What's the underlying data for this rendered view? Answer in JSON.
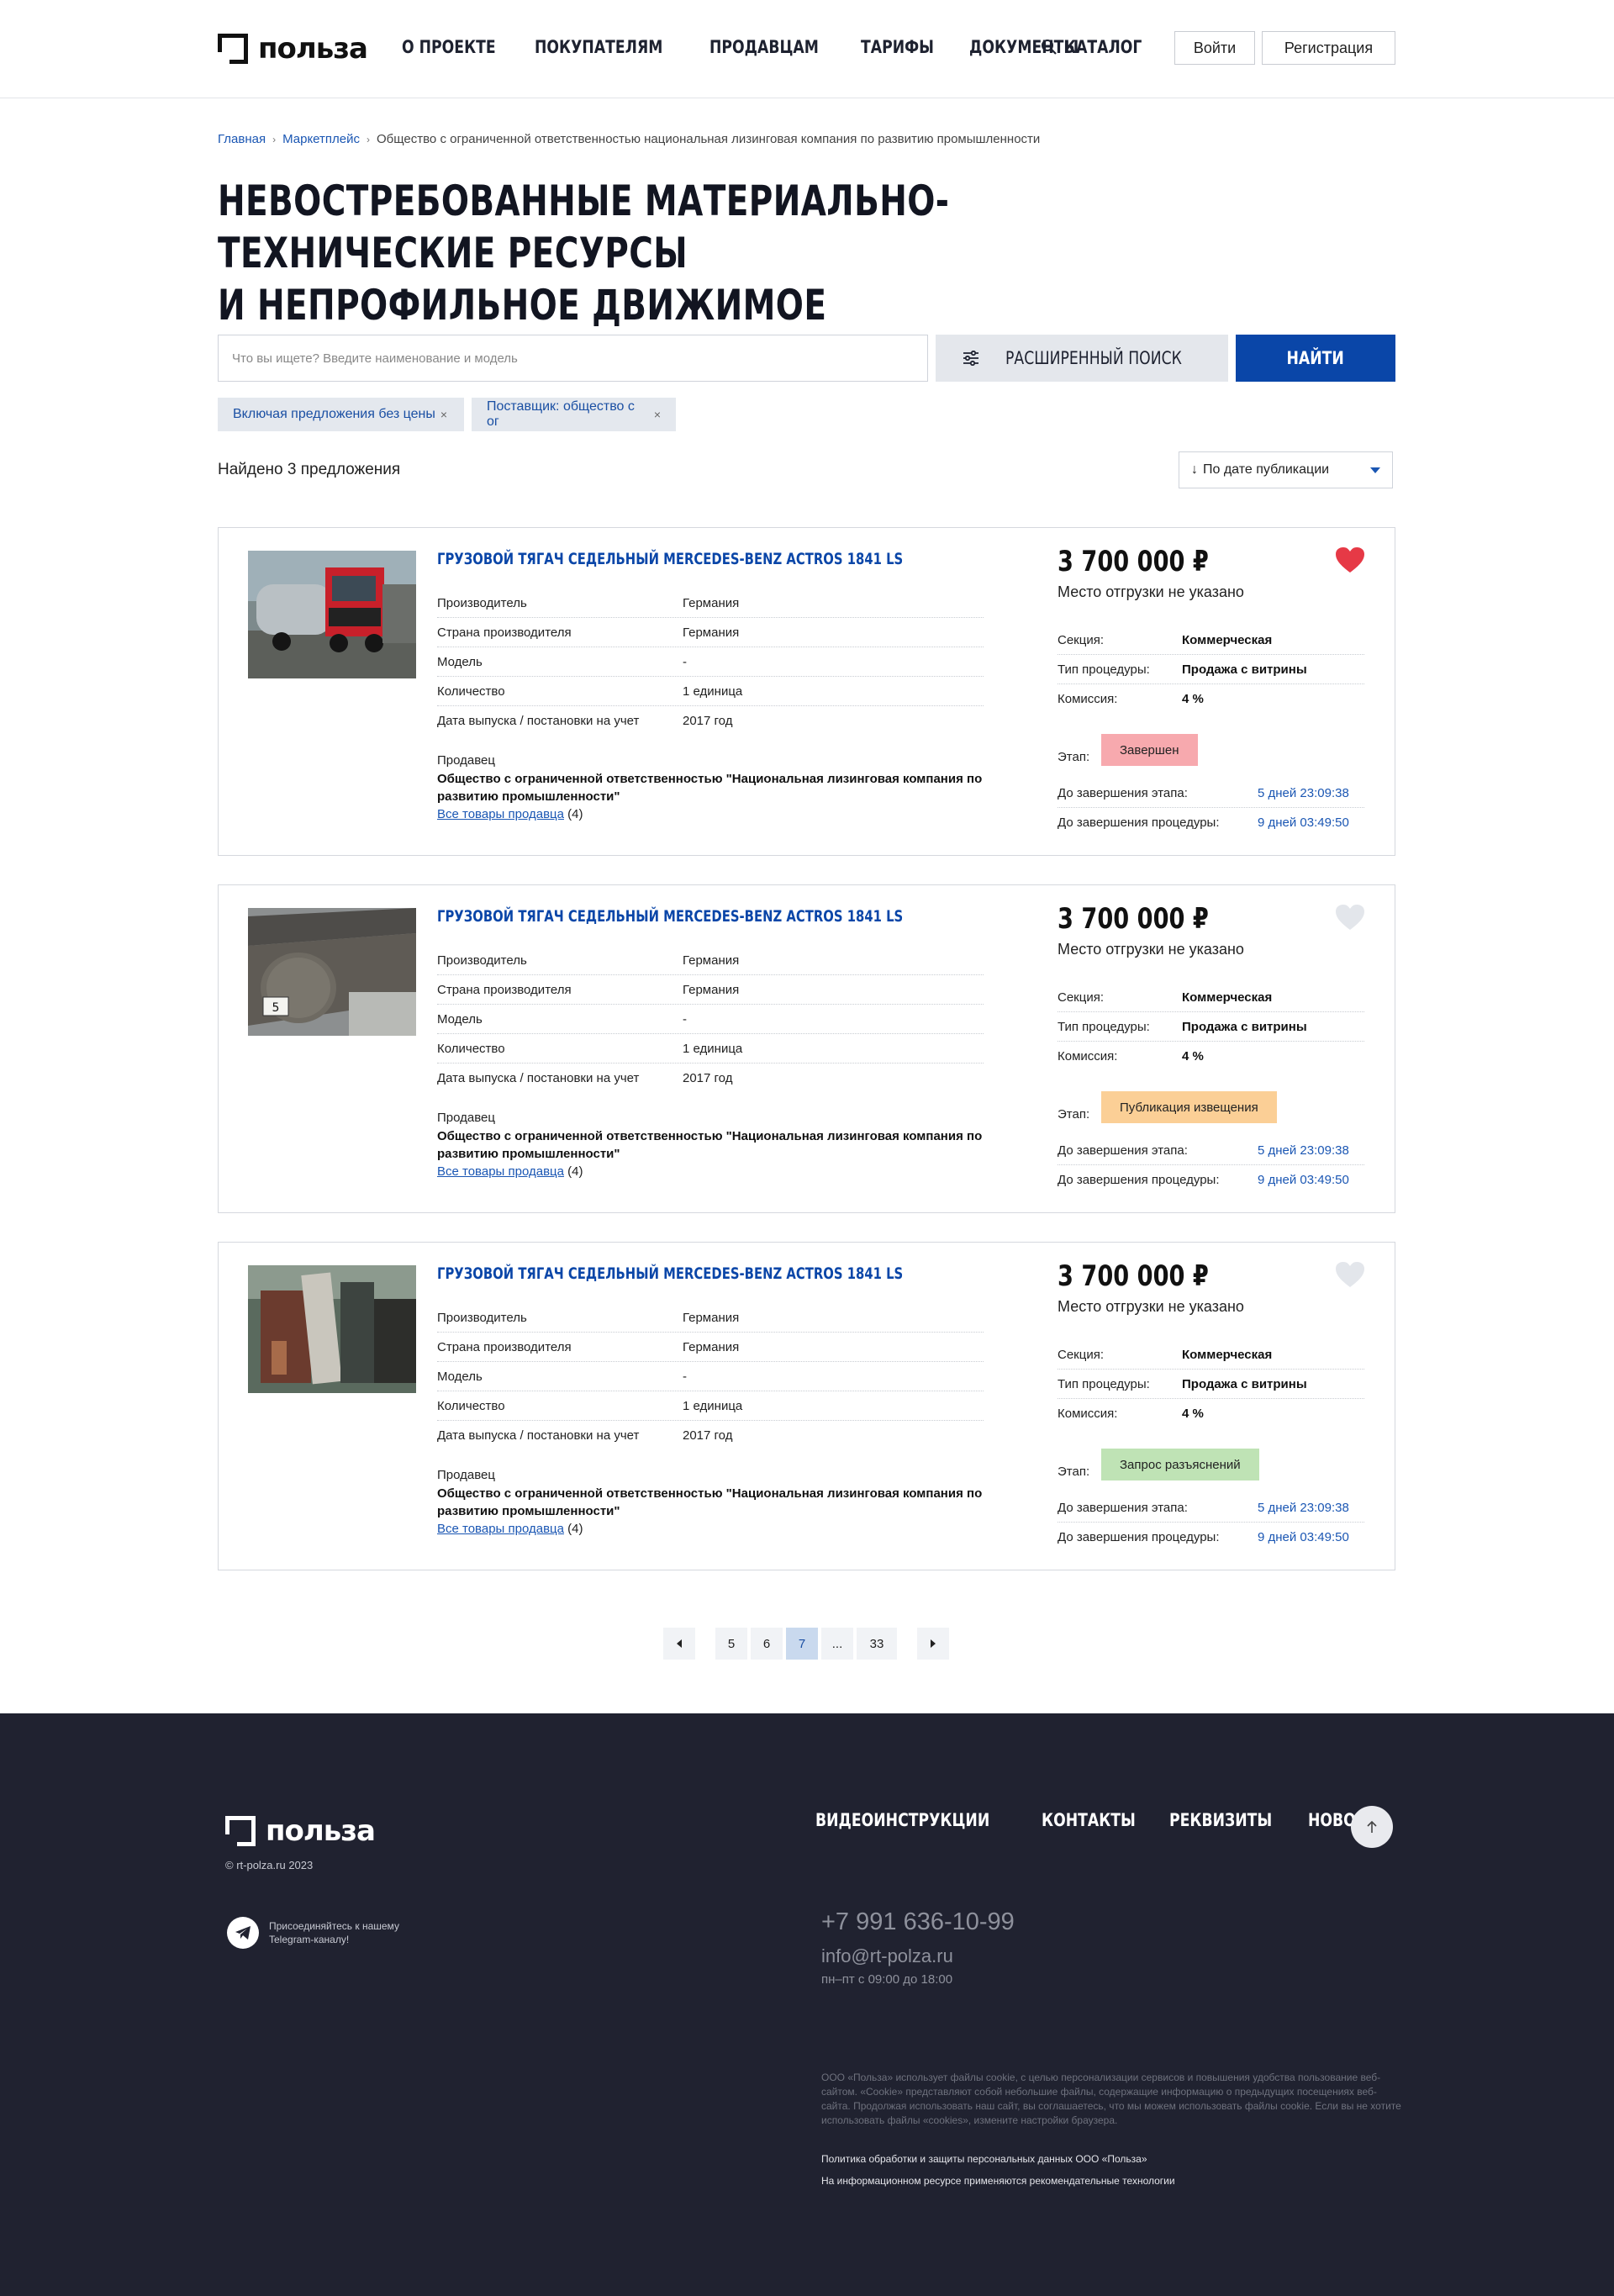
{
  "header": {
    "logo": "польза",
    "nav": [
      "О ПРОЕКТЕ",
      "ПОКУПАТЕЛЯМ",
      "ПРОДАВЦАМ",
      "ТАРИФЫ",
      "ДОКУМЕНТЫ"
    ],
    "catalog": "КАТАЛОГ",
    "login": "Войти",
    "register": "Регистрация"
  },
  "breadcrumbs": [
    "Главная",
    "Маркетплейс",
    "Общество с ограниченной ответственностью национальная лизинговая компания по развитию промышленности"
  ],
  "title_line1": "НЕВОСТРЕБОВАННЫЕ МАТЕРИАЛЬНО-ТЕХНИЧЕСКИЕ РЕСУРСЫ",
  "title_line2": "И НЕПРОФИЛЬНОЕ ДВИЖИМОЕ ИМУЩЕСТВО",
  "search": {
    "placeholder": "Что вы ищете? Введите наименование и модель",
    "advanced": "РАСШИРЕННЫЙ ПОИСК",
    "find": "НАЙТИ"
  },
  "filters": [
    "Включая предложения без цены",
    "Поставщик: общество с ог"
  ],
  "found": "Найдено 3 предложения",
  "sort": "По дате публикации",
  "spec_labels": [
    "Производитель",
    "Страна производителя",
    "Модель",
    "Количество",
    "Дата выпуска / постановки на учет"
  ],
  "right_labels": [
    "Секция:",
    "Тип процедуры:",
    "Комиссия:"
  ],
  "stage_label": "Этап:",
  "time_labels": [
    "До завершения этапа:",
    "До завершения процедуры:"
  ],
  "seller_label": "Продавец",
  "all_goods": "Все товары продавца",
  "colors": {
    "accent": "#0a46a8",
    "stage_done": "#f7a9ae",
    "stage_publish": "#fbcf96",
    "stage_request": "#bfe3b5",
    "heart_active": "#e63946",
    "heart_inactive": "#e3e6eb"
  },
  "cards": [
    {
      "title": "ГРУЗОВОЙ ТЯГАЧ СЕДЕЛЬНЫЙ MERCEDES-BENZ ACTROS 1841 LS",
      "specs": [
        "Германия",
        "Германия",
        "-",
        "1 единица",
        "2017 год"
      ],
      "seller": "Общество с ограниченной ответственностью \"Национальная лизинговая компания по развитию промышленности\"",
      "seller_count": "(4)",
      "price": "3 700 000",
      "currency": "₽",
      "shipping": "Место отгрузки не указано",
      "section": "Коммерческая",
      "procedure": "Продажа с витрины",
      "commission": "4 %",
      "stage": "Завершен",
      "stage_end": "5 дней 23:09:38",
      "procedure_end": "9 дней 03:49:50",
      "favorite": true,
      "image": "truck-photo"
    },
    {
      "title": "ГРУЗОВОЙ ТЯГАЧ СЕДЕЛЬНЫЙ MERCEDES-BENZ ACTROS 1841 LS",
      "specs": [
        "Германия",
        "Германия",
        "-",
        "1 единица",
        "2017 год"
      ],
      "seller": "Общество с ограниченной ответственностью \"Национальная лизинговая компания по развитию промышленности\"",
      "seller_count": "(4)",
      "price": "3 700 000",
      "currency": "₽",
      "shipping": "Место отгрузки не указано",
      "section": "Коммерческая",
      "procedure": "Продажа с витрины",
      "commission": "4 %",
      "stage": "Публикация извещения",
      "stage_end": "5 дней 23:09:38",
      "procedure_end": "9 дней 03:49:50",
      "favorite": false,
      "image": "steel-bar-photo",
      "image_tag": "5"
    },
    {
      "title": "ГРУЗОВОЙ ТЯГАЧ СЕДЕЛЬНЫЙ MERCEDES-BENZ ACTROS 1841 LS",
      "specs": [
        "Германия",
        "Германия",
        "-",
        "1 единица",
        "2017 год"
      ],
      "seller": "Общество с ограниченной ответственностью \"Национальная лизинговая компания по развитию промышленности\"",
      "seller_count": "(4)",
      "price": "3 700 000",
      "currency": "₽",
      "shipping": "Место отгрузки не указано",
      "section": "Коммерческая",
      "procedure": "Продажа с витрины",
      "commission": "4 %",
      "stage": "Запрос разъяснений",
      "stage_end": "5 дней 23:09:38",
      "procedure_end": "9 дней 03:49:50",
      "favorite": false,
      "image": "warehouse-photo"
    }
  ],
  "pagination": [
    "5",
    "6",
    "7",
    "...",
    "33"
  ],
  "pagination_active": "7",
  "footer": {
    "logo": "польза",
    "copyright": "© rt-polza.ru 2023",
    "telegram": "Присоединяйтесь к нашему Telegram-каналу!",
    "nav": [
      "ВИДЕОИНСТРУКЦИИ",
      "КОНТАКТЫ",
      "РЕКВИЗИТЫ",
      "НОВОСТИ"
    ],
    "phone": "+7 991 636-10-99",
    "email": "info@rt-polza.ru",
    "hours": "пн–пт с 09:00 до 18:00",
    "cookie": "ООО «Польза» использует файлы cookie, с целью персонализации сервисов и повышения удобства пользование веб-сайтом. «Cookie» представляют собой небольшие файлы, содержащие информацию о предыдущих посещениях веб-сайта. Продолжая использовать наш сайт, вы соглашаетесь, что мы можем использовать файлы cookie. Если вы не хотите использовать файлы «cookies», измените настройки браузера.",
    "policy": "Политика обработки и защиты персональных данных ООО «Польза»",
    "tech": "На информационном ресурсе применяются рекомендательные технологии"
  }
}
